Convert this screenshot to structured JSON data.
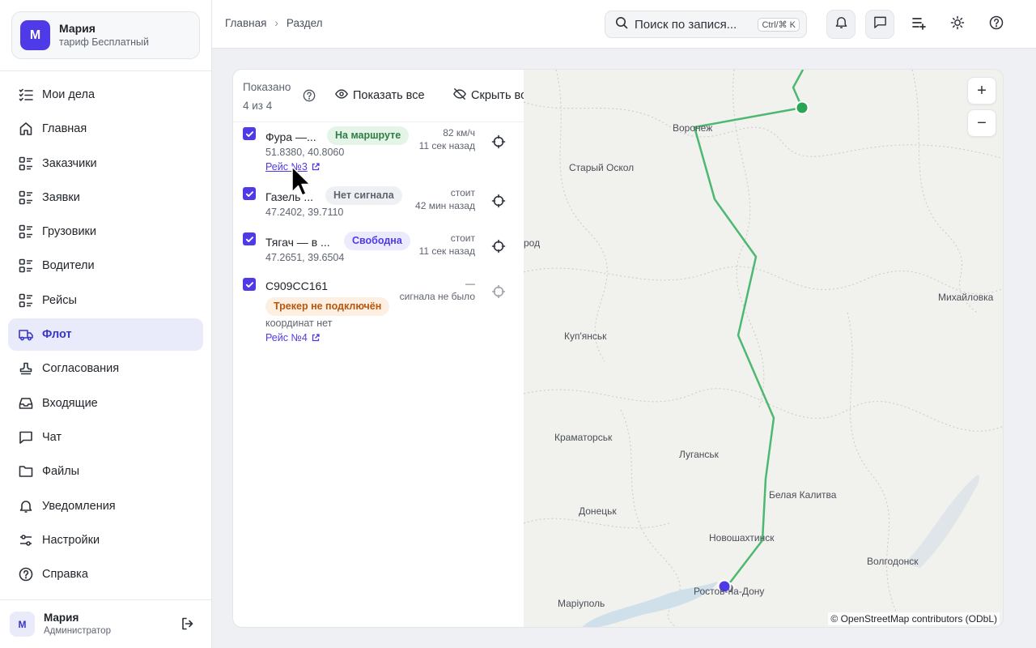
{
  "user": {
    "initial": "М",
    "name": "Мария",
    "plan": "тариф Бесплатный"
  },
  "nav": {
    "items": [
      {
        "label": "Мои дела",
        "icon": "checklist-icon"
      },
      {
        "label": "Главная",
        "icon": "home-icon"
      },
      {
        "label": "Заказчики",
        "icon": "list-icon"
      },
      {
        "label": "Заявки",
        "icon": "list-icon"
      },
      {
        "label": "Грузовики",
        "icon": "list-icon"
      },
      {
        "label": "Водители",
        "icon": "list-icon"
      },
      {
        "label": "Рейсы",
        "icon": "list-icon"
      },
      {
        "label": "Флот",
        "icon": "truck-icon",
        "active": true
      },
      {
        "label": "Согласования",
        "icon": "stamp-icon"
      },
      {
        "label": "Входящие",
        "icon": "inbox-icon"
      },
      {
        "label": "Чат",
        "icon": "chat-icon"
      },
      {
        "label": "Файлы",
        "icon": "folder-icon"
      },
      {
        "label": "Уведомления",
        "icon": "bell-icon"
      },
      {
        "label": "Настройки",
        "icon": "sliders-icon"
      },
      {
        "label": "Справка",
        "icon": "help-icon"
      }
    ]
  },
  "footer": {
    "initial": "М",
    "name": "Мария",
    "role": "Администратор"
  },
  "breadcrumbs": {
    "home": "Главная",
    "current": "Раздел"
  },
  "search": {
    "placeholder": "Поиск по записям",
    "display": "Поиск по запися...",
    "shortcut": "Ctrl/⌘ K"
  },
  "panel": {
    "shown_label": "Показано",
    "shown_count": "4 из 4",
    "show_all": "Показать все",
    "hide_all": "Скрыть все",
    "vehicles": [
      {
        "name": "Фура —...",
        "status": "На маршруте",
        "coords": "51.8380, 40.8060",
        "speed": "82 км/ч",
        "time": "11 сек назад",
        "trip": "Рейс №3"
      },
      {
        "name": "Газель ...",
        "status": "Нет сигнала",
        "coords": "47.2402, 39.7110",
        "speed": "стоит",
        "time": "42 мин назад"
      },
      {
        "name": "Тягач — в ...",
        "status": "Свободна",
        "coords": "47.2651, 39.6504",
        "speed": "стоит",
        "time": "11 сек назад"
      },
      {
        "name": "С909СС161",
        "status": "Трекер не подключён",
        "coords": "координат нет",
        "speed": "—",
        "time": "сигнала не было",
        "trip": "Рейс №4"
      }
    ]
  },
  "map": {
    "zoom_in": "+",
    "zoom_out": "−",
    "cities": [
      "Воронеж",
      "Старый Оскол",
      "род",
      "Михайловка",
      "Куп'янськ",
      "Краматорськ",
      "Луганськ",
      "Белая Калитва",
      "Донецьк",
      "Новошахтинск",
      "Волгодонск",
      "Ростов-на-Дону",
      "Маріуполь"
    ],
    "attribution": "© OpenStreetMap contributors (ODbL)",
    "route_color": "#4cb871",
    "marker_colors": {
      "moving": "#29a653",
      "stopped": "#4f3ae8"
    }
  },
  "colors": {
    "accent": "#4f3ae8"
  }
}
